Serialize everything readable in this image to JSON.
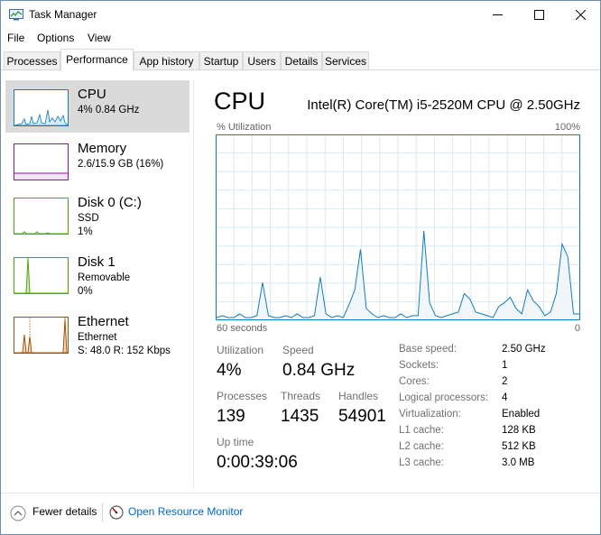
{
  "window": {
    "title": "Task Manager",
    "minimize_icon": "minimize-icon",
    "maximize_icon": "maximize-icon",
    "close_icon": "close-icon"
  },
  "menu": [
    "File",
    "Options",
    "View"
  ],
  "tabs": [
    "Processes",
    "Performance",
    "App history",
    "Startup",
    "Users",
    "Details",
    "Services"
  ],
  "active_tab": "Performance",
  "sidebar": {
    "items": [
      {
        "name": "CPU",
        "lines": [
          "4%  0.84 GHz"
        ],
        "color": "#117dbb"
      },
      {
        "name": "Memory",
        "lines": [
          "2.6/15.9 GB (16%)"
        ],
        "color": "#8b12ae"
      },
      {
        "name": "Disk 0 (C:)",
        "lines": [
          "SSD",
          "1%"
        ],
        "color": "#4da60c"
      },
      {
        "name": "Disk 1",
        "lines": [
          "Removable",
          "0%"
        ],
        "color": "#4da60c"
      },
      {
        "name": "Ethernet",
        "lines": [
          "Ethernet",
          "S: 48.0  R: 152 Kbps"
        ],
        "color": "#a74f01"
      }
    ]
  },
  "main": {
    "title": "CPU",
    "model": "Intel(R) Core(TM) i5-2520M CPU @ 2.50GHz",
    "y_label": "% Utilization",
    "y_max_label": "100%",
    "x_left_label": "60 seconds",
    "x_right_label": "0",
    "stats": {
      "utilization_label": "Utilization",
      "utilization": "4%",
      "speed_label": "Speed",
      "speed": "0.84 GHz",
      "processes_label": "Processes",
      "processes": "139",
      "threads_label": "Threads",
      "threads": "1435",
      "handles_label": "Handles",
      "handles": "54901",
      "uptime_label": "Up time",
      "uptime": "0:00:39:06"
    },
    "specs": [
      {
        "label": "Base speed:",
        "value": "2.50 GHz"
      },
      {
        "label": "Sockets:",
        "value": "1"
      },
      {
        "label": "Cores:",
        "value": "2"
      },
      {
        "label": "Logical processors:",
        "value": "4"
      },
      {
        "label": "Virtualization:",
        "value": "Enabled"
      },
      {
        "label": "L1 cache:",
        "value": "128 KB"
      },
      {
        "label": "L2 cache:",
        "value": "512 KB"
      },
      {
        "label": "L3 cache:",
        "value": "3.0 MB"
      }
    ]
  },
  "footer": {
    "fewer_details": "Fewer details",
    "open_resource_monitor": "Open Resource Monitor"
  },
  "chart_data": {
    "type": "area",
    "title": "CPU",
    "ylabel": "% Utilization",
    "ylim": [
      0,
      100
    ],
    "xlim": [
      60,
      0
    ],
    "x": [
      60,
      59,
      58,
      57,
      56,
      55,
      54,
      53,
      52,
      51,
      50,
      49,
      48,
      47,
      46,
      45,
      44,
      43,
      42,
      41,
      40,
      39,
      38,
      37,
      36,
      35,
      34,
      33,
      32,
      31,
      30,
      29,
      28,
      27,
      26,
      25,
      24,
      23,
      22,
      21,
      20,
      19,
      18,
      17,
      16,
      15,
      14,
      13,
      12,
      11,
      10,
      9,
      8,
      7,
      6,
      5,
      4,
      3,
      2,
      1,
      0
    ],
    "series": [
      {
        "values": [
          1,
          2,
          1,
          1,
          3,
          1,
          1,
          2,
          20,
          2,
          1,
          1,
          2,
          1,
          3,
          1,
          1,
          2,
          23,
          3,
          1,
          2,
          1,
          8,
          16,
          38,
          6,
          3,
          1,
          2,
          1,
          1,
          3,
          1,
          2,
          2,
          48,
          9,
          2,
          1,
          2,
          3,
          4,
          14,
          11,
          4,
          3,
          2,
          1,
          7,
          9,
          12,
          6,
          3,
          16,
          10,
          7,
          2,
          4,
          14,
          41,
          34,
          3,
          3
        ]
      }
    ],
    "color": "#117dbb",
    "grid": true
  }
}
